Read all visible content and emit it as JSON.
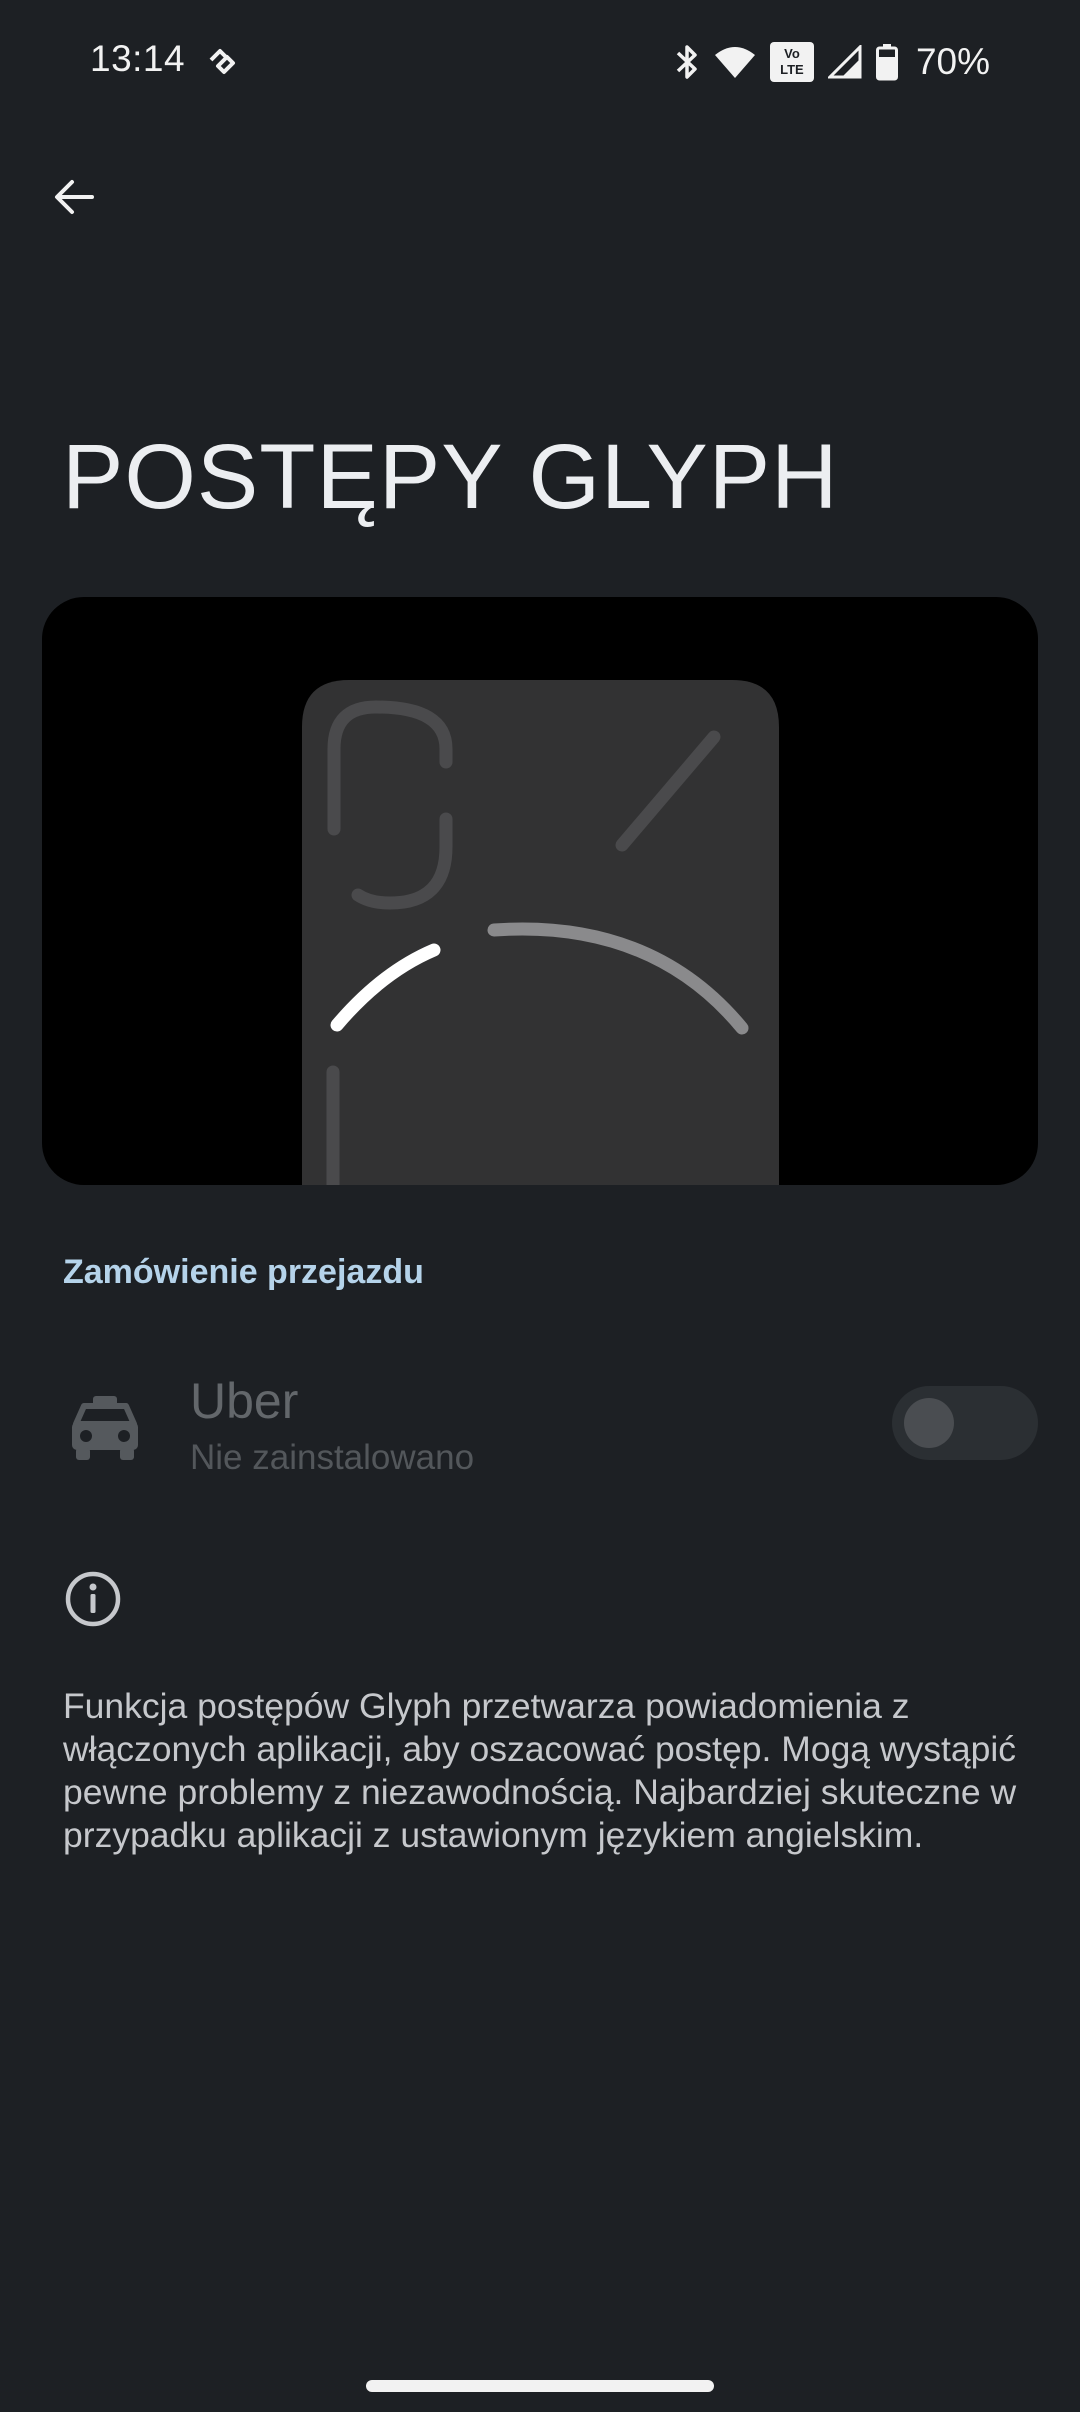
{
  "status_bar": {
    "time": "13:14",
    "battery": "70%",
    "volte_top": "Vo",
    "volte_bottom": "LTE",
    "icons": [
      "app-notification-icon",
      "bluetooth-icon",
      "wifi-icon",
      "volte-icon",
      "signal-icon",
      "battery-icon"
    ]
  },
  "header": {
    "back_icon": "arrow-left-icon",
    "title": "POSTĘPY GLYPH"
  },
  "preview": {
    "glyph_active_color": "#ffffff",
    "glyph_dim_color": "#4a4a4c",
    "glyph_mid_color": "#8a8a8c",
    "phone_color": "#323233"
  },
  "section": {
    "title": "Zamówienie przejazdu"
  },
  "apps": [
    {
      "icon": "car-icon",
      "name": "Uber",
      "status": "Nie zainstalowano",
      "enabled": false
    }
  ],
  "info": {
    "icon": "info-icon",
    "text": "Funkcja postępów Glyph przetwarza powiadomienia z włączonych aplikacji, aby oszacować postęp. Mogą wystąpić pewne problemy z niezawodnością. Najbardziej skuteczne w przypadku aplikacji z ustawionym językiem angielskim."
  },
  "colors": {
    "background": "#1d2024",
    "accent": "#b5d3ea"
  }
}
